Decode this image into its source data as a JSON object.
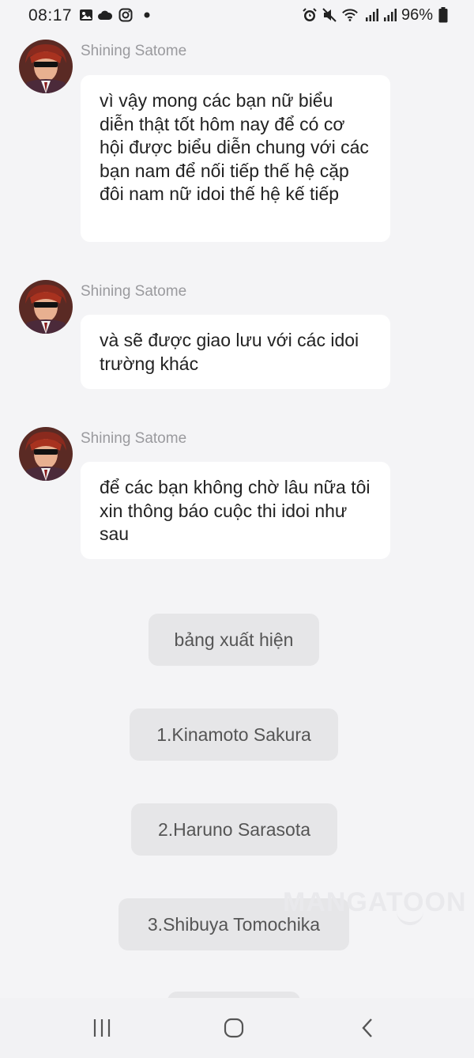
{
  "status_bar": {
    "time": "08:17",
    "battery_percent": "96%",
    "left_icons": [
      "gallery-icon",
      "cloud-icon",
      "instagram-icon",
      "dot-icon"
    ],
    "right_icons": [
      "alarm-icon",
      "mute-icon",
      "wifi-icon",
      "signal-icon",
      "signal-icon",
      "battery-icon"
    ]
  },
  "messages": [
    {
      "sender": "Shining Satome",
      "text": "vì vậy mong các bạn nữ biểu diễn thật tốt hôm nay để có cơ hội được biểu diễn chung với các bạn nam để nối tiếp thế hệ cặp đôi nam nữ idoi thế hệ kế tiếp"
    },
    {
      "sender": "Shining Satome",
      "text": "và sẽ được giao lưu với các idoi trường khác"
    },
    {
      "sender": "Shining Satome",
      "text": "để các bạn không chờ lâu nữa tôi xin thông báo cuộc thi idoi như sau"
    }
  ],
  "narration": [
    "bảng xuất hiện",
    "1.Kinamoto Sakura",
    "2.Haruno Sarasota",
    "3.Shibuya Tomochika"
  ],
  "watermark": "MANGATOON",
  "colors": {
    "background": "#f4f4f6",
    "bubble": "#ffffff",
    "pill": "#e6e6e8",
    "sender_name": "#9a9a9e"
  },
  "nav": {
    "icons": [
      "recent-apps-icon",
      "home-icon",
      "back-icon"
    ]
  }
}
